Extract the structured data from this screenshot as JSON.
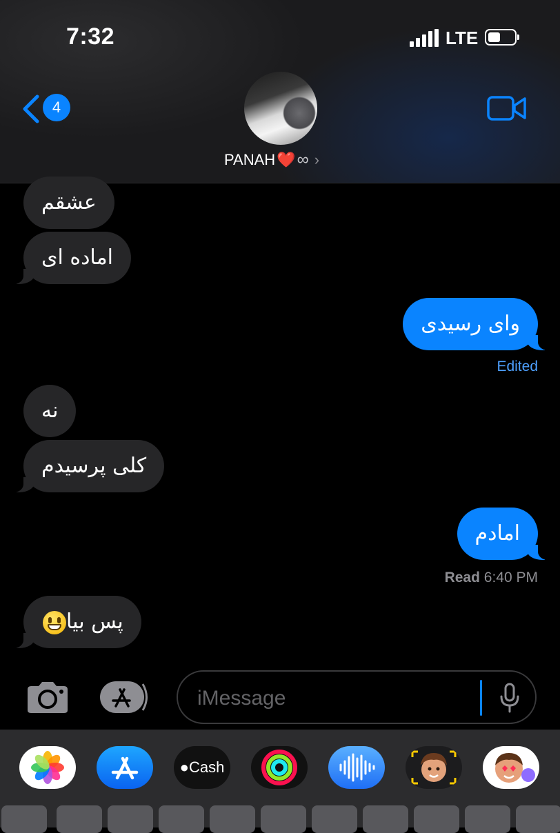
{
  "status_bar": {
    "time": "7:32",
    "carrier": "LTE",
    "battery_level": 0.45
  },
  "header": {
    "back_badge": "4",
    "contact_name": "PANAH",
    "name_heart": "❤️",
    "name_infinity": "∞",
    "chevron": "›"
  },
  "messages": [
    {
      "direction": "received",
      "text": "عشقم"
    },
    {
      "direction": "received",
      "text": "اماده ای"
    },
    {
      "direction": "sent",
      "text": "وای رسیدی",
      "note": "Edited"
    },
    {
      "direction": "received",
      "text": "نه"
    },
    {
      "direction": "received",
      "text": "کلی پرسیدم"
    },
    {
      "direction": "sent",
      "text": "امادم"
    },
    {
      "direction": "received",
      "text": "پس بیا",
      "emoji": "grinning-face"
    }
  ],
  "read_receipt": {
    "label": "Read",
    "time": "6:40 PM"
  },
  "composer": {
    "placeholder": "iMessage"
  },
  "app_drawer": [
    {
      "name": "photos-app"
    },
    {
      "name": "app-store-app"
    },
    {
      "name": "apple-cash-app",
      "label": "Cash"
    },
    {
      "name": "activity-app"
    },
    {
      "name": "audio-message-app"
    },
    {
      "name": "memoji-app"
    },
    {
      "name": "memoji-stickers-app"
    }
  ],
  "colors": {
    "accent": "#0a84ff",
    "received_bubble": "#262628",
    "sent_bubble": "#0a84ff",
    "background": "#000000"
  }
}
